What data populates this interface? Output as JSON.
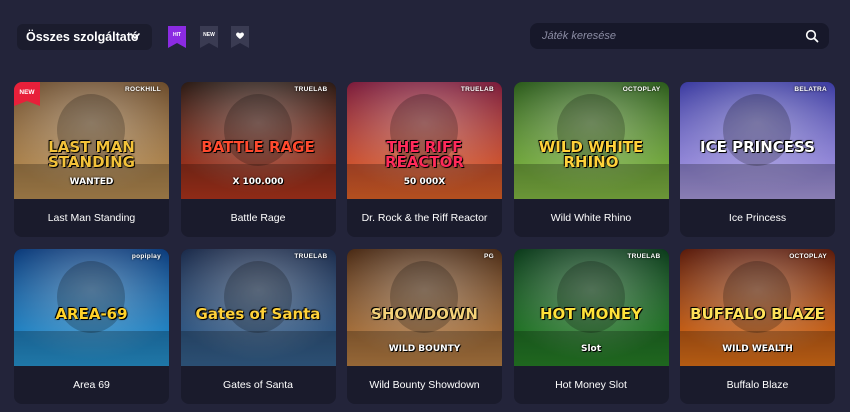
{
  "toolbar": {
    "provider_filter": "Összes szolgáltató",
    "flags": [
      {
        "label": "HIT",
        "color": "#8b2be2"
      },
      {
        "label": "NEW",
        "color": "#3a3b52"
      },
      {
        "label": "",
        "icon": "heart-icon",
        "color": "#3a3b52"
      }
    ]
  },
  "search": {
    "placeholder": "Játék keresése"
  },
  "games": [
    {
      "title": "Last Man Standing",
      "art": "LAST MAN STANDING",
      "art_sub": "WANTED",
      "provider": "ROCKHILL",
      "badge": "NEW",
      "bg": [
        "#6a4a2a",
        "#c79a5a"
      ],
      "art_color": "#f3c23a"
    },
    {
      "title": "Battle Rage",
      "art": "BATTLE RAGE",
      "art_sub": "X 100.000",
      "provider": "TRUELAB",
      "badge": "",
      "bg": [
        "#2a1a14",
        "#c0391f"
      ],
      "art_color": "#ff4a2e"
    },
    {
      "title": "Dr. Rock & the Riff Reactor",
      "art": "THE RIFF REACTOR",
      "art_sub": "50 000X",
      "provider": "TRUELAB",
      "badge": "",
      "bg": [
        "#7a1a3a",
        "#f06a2a"
      ],
      "art_color": "#ff2a5a"
    },
    {
      "title": "Wild White Rhino",
      "art": "WILD WHITE RHINO",
      "art_sub": "",
      "provider": "OCTOPLAY",
      "badge": "",
      "bg": [
        "#2a5a1a",
        "#8fc84a"
      ],
      "art_color": "#ffd23a"
    },
    {
      "title": "Ice Princess",
      "art": "ICE PRINCESS",
      "art_sub": "",
      "provider": "BELATRA",
      "badge": "",
      "bg": [
        "#3a3aa0",
        "#b8a8f0"
      ],
      "art_color": "#ffffff"
    },
    {
      "title": "Area 69",
      "art": "AREA-69",
      "art_sub": "",
      "provider": "popiplay",
      "badge": "",
      "bg": [
        "#0a3a7a",
        "#2aa0e0"
      ],
      "art_color": "#ffd22a"
    },
    {
      "title": "Gates of Santa",
      "art": "Gates of Santa",
      "art_sub": "",
      "provider": "TRUELAB",
      "badge": "",
      "bg": [
        "#1a2a4a",
        "#3a6a9a"
      ],
      "art_color": "#ffd23a"
    },
    {
      "title": "Wild Bounty Showdown",
      "art": "SHOWDOWN",
      "art_sub": "WILD BOUNTY",
      "provider": "PG",
      "badge": "",
      "bg": [
        "#4a2a14",
        "#c88a4a"
      ],
      "art_color": "#f4d27a"
    },
    {
      "title": "Hot Money Slot",
      "art": "HOT MONEY",
      "art_sub": "Slot",
      "provider": "TRUELAB",
      "badge": "",
      "bg": [
        "#0a3a1a",
        "#2a8a2a"
      ],
      "art_color": "#ffe23a"
    },
    {
      "title": "Buffalo Blaze",
      "art": "BUFFALO BLAZE",
      "art_sub": "WILD WEALTH",
      "provider": "OCTOPLAY",
      "badge": "",
      "bg": [
        "#5a1a0a",
        "#f07a1a"
      ],
      "art_color": "#ffe25a"
    }
  ]
}
